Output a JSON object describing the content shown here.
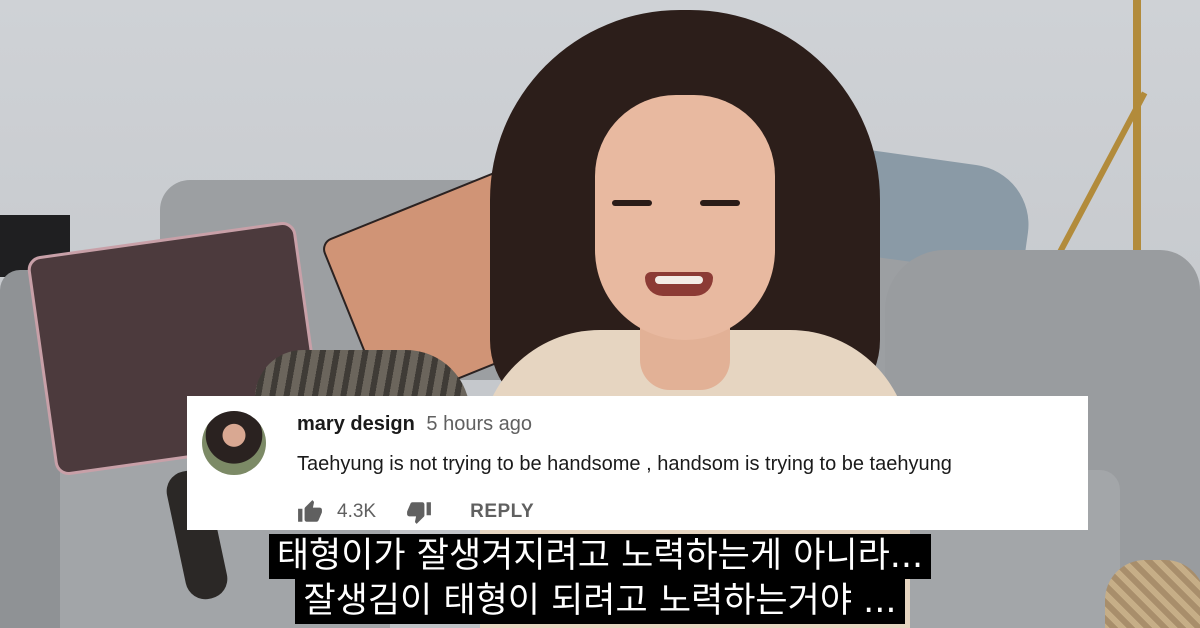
{
  "comment": {
    "author": "mary design",
    "time": "5 hours ago",
    "text": "Taehyung is not trying to be handsome , handsom is trying to be taehyung",
    "like_count": "4.3K",
    "reply_label": "REPLY",
    "icons": {
      "like": "thumbs-up-icon",
      "dislike": "thumbs-down-icon"
    }
  },
  "subtitles": [
    "태형이가 잘생겨지려고 노력하는게 아니라...",
    "잘생김이 태형이 되려고 노력하는거야 ..."
  ],
  "colors": {
    "card_background": "#ffffff",
    "subtitle_background": "#000000",
    "subtitle_text": "#ffffff",
    "secondary_text": "#606060"
  }
}
